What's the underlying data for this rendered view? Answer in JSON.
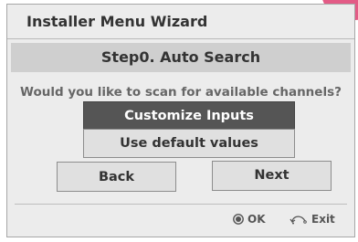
{
  "dialog": {
    "title": "Installer Menu Wizard",
    "step_title": "Step0. Auto Search",
    "question": "Would you like to scan for available channels?"
  },
  "buttons": {
    "customize_inputs": "Customize Inputs",
    "use_default_values": "Use default values",
    "back": "Back",
    "next": "Next"
  },
  "footer": {
    "ok_label": "OK",
    "exit_label": "Exit",
    "ok_icon": "ok-button-icon",
    "exit_icon": "back-arrow-icon"
  },
  "colors": {
    "dialog_background": "#ececec",
    "step_bar": "#cfcfcf",
    "selected_button": "#555555",
    "button": "#e0e0e0",
    "corner_accent": "#e35b86"
  }
}
